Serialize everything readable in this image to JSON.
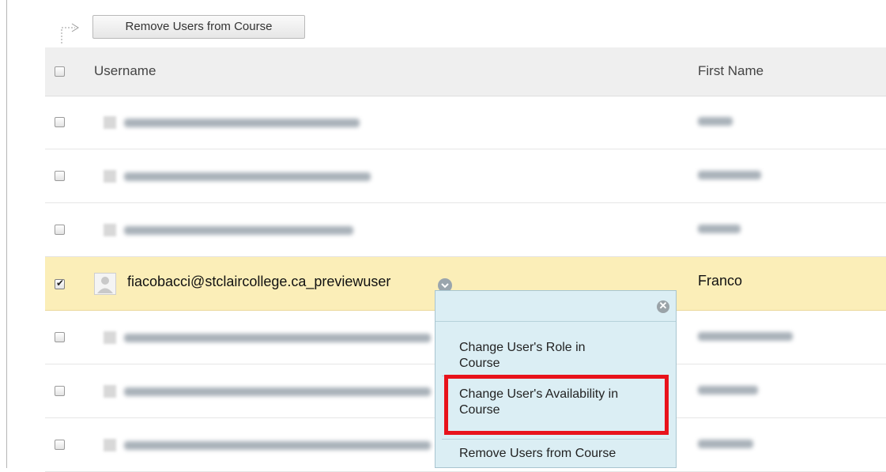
{
  "toolbar": {
    "remove_button_label": "Remove Users from Course"
  },
  "table": {
    "headers": {
      "username": "Username",
      "first_name": "First Name"
    },
    "selected_row": {
      "username": "fiacobacci@stclaircollege.ca_previewuser",
      "first_name": "Franco",
      "checked": true
    }
  },
  "context_menu": {
    "items": [
      {
        "label_line1": "Change User's Role in",
        "label_line2": "Course"
      },
      {
        "label_line1": "Change User's Availability in",
        "label_line2": "Course"
      },
      {
        "label_line1": "Remove Users from Course"
      }
    ],
    "highlighted_index": 1
  },
  "colors": {
    "selected_row": "#fbeeb8",
    "menu_bg": "#dbeef4",
    "highlight_box": "#e8121b"
  }
}
